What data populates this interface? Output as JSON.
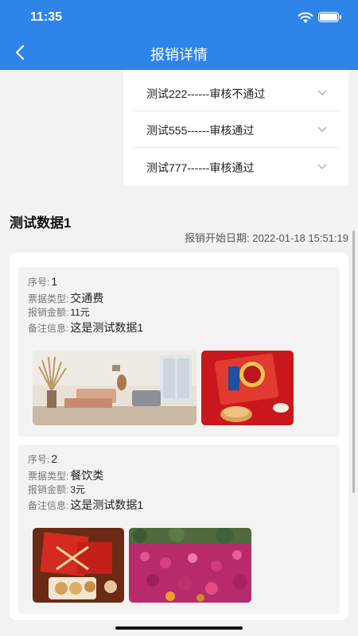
{
  "status": {
    "time": "11:35"
  },
  "nav": {
    "title": "报销详情"
  },
  "dropdown": {
    "items": [
      "测试222------审核不通过",
      "测试555------审核通过",
      "测试777------审核通过"
    ]
  },
  "detail": {
    "name": "测试数据1",
    "start_label": "报销开始日期:",
    "start_value": "2022-01-18 15:51:19"
  },
  "labels": {
    "index": "序号:",
    "type": "票据类型:",
    "amount": "报销金额:",
    "note": "备注信息:"
  },
  "records": [
    {
      "index": "1",
      "type": "交通费",
      "amount": "11元",
      "note": "这是测试数据1",
      "photos": [
        "living-room-photo",
        "red-gift-box-photo"
      ]
    },
    {
      "index": "2",
      "type": "餐饮类",
      "amount": "3元",
      "note": "这是测试数据1",
      "photos": [
        "mooncake-photo",
        "flower-field-photo"
      ]
    }
  ],
  "colors": {
    "primary": "#2f84ea",
    "background": "#f2f2f2"
  }
}
